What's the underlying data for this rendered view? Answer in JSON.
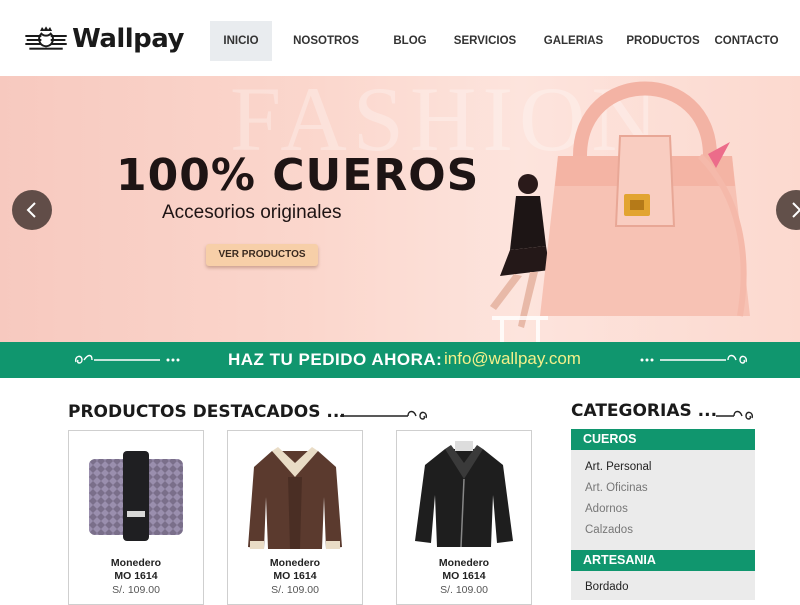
{
  "brand": {
    "name": "Wallpay"
  },
  "nav": {
    "items": [
      "INICIO",
      "NOSOTROS",
      "BLOG",
      "SERVICIOS",
      "GALERIAS",
      "PRODUCTOS",
      "CONTACTO"
    ],
    "active": "INICIO"
  },
  "hero": {
    "background_word": "FASHION",
    "title": "100% CUEROS",
    "subtitle": "Accesorios originales",
    "button": "VER PRODUCTOS"
  },
  "strip": {
    "text": "HAZ TU PEDIDO AHORA:",
    "email": "info@wallpay.com",
    "color": "#10966e",
    "email_color": "#f3f08a"
  },
  "products": {
    "title": "PRODUCTOS DESTACADOS ...",
    "items": [
      {
        "name": "Monedero",
        "code": "MO 1614",
        "price": "S/. 109.00",
        "icon": "wallet-image"
      },
      {
        "name": "Monedero",
        "code": "MO 1614",
        "price": "S/. 109.00",
        "icon": "jacket-image"
      },
      {
        "name": "Monedero",
        "code": "MO 1614",
        "price": "S/. 109.00",
        "icon": "leather-jacket-image"
      }
    ]
  },
  "categories": {
    "title": "CATEGORIAS ...",
    "groups": [
      {
        "label": "CUEROS",
        "items": [
          "Art. Personal",
          "Art. Oficinas",
          "Adornos",
          "Calzados"
        ]
      },
      {
        "label": "ARTESANIA",
        "items": [
          "Bordado"
        ]
      }
    ]
  }
}
